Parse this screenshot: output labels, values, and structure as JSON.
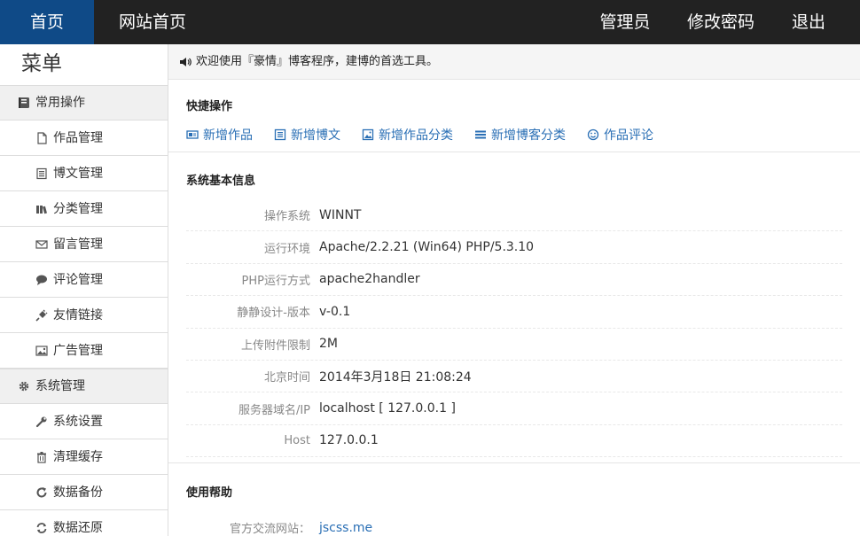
{
  "topbar": {
    "left": [
      "首页",
      "网站首页"
    ],
    "right": [
      "管理员",
      "修改密码",
      "退出"
    ]
  },
  "sidebar": {
    "title": "菜单",
    "groups": [
      {
        "label": "常用操作",
        "icon": "book-icon",
        "items": [
          {
            "label": "作品管理",
            "icon": "file-icon"
          },
          {
            "label": "博文管理",
            "icon": "list-icon"
          },
          {
            "label": "分类管理",
            "icon": "books-icon"
          },
          {
            "label": "留言管理",
            "icon": "envelope-icon"
          },
          {
            "label": "评论管理",
            "icon": "comment-icon"
          },
          {
            "label": "友情链接",
            "icon": "plug-icon"
          },
          {
            "label": "广告管理",
            "icon": "picture-icon"
          }
        ]
      },
      {
        "label": "系统管理",
        "icon": "gear-icon",
        "items": [
          {
            "label": "系统设置",
            "icon": "wrench-icon"
          },
          {
            "label": "清理缓存",
            "icon": "trash-icon"
          },
          {
            "label": "数据备份",
            "icon": "refresh-icon"
          },
          {
            "label": "数据还原",
            "icon": "sync-icon"
          }
        ]
      }
    ]
  },
  "notice": {
    "icon": "speaker-icon",
    "text": "欢迎使用『豪情』博客程序，建博的首选工具。"
  },
  "quick": {
    "title": "快捷操作",
    "links": [
      {
        "label": "新增作品",
        "icon": "card-icon"
      },
      {
        "label": "新增博文",
        "icon": "list-box-icon"
      },
      {
        "label": "新增作品分类",
        "icon": "image-box-icon"
      },
      {
        "label": "新增博客分类",
        "icon": "bars-icon"
      },
      {
        "label": "作品评论",
        "icon": "smile-icon"
      }
    ]
  },
  "sysinfo": {
    "title": "系统基本信息",
    "rows": [
      {
        "label": "操作系统",
        "value": "WINNT"
      },
      {
        "label": "运行环境",
        "value": "Apache/2.2.21 (Win64) PHP/5.3.10"
      },
      {
        "label": "PHP运行方式",
        "value": "apache2handler"
      },
      {
        "label": "静静设计-版本",
        "value": "v-0.1"
      },
      {
        "label": "上传附件限制",
        "value": "2M"
      },
      {
        "label": "北京时间",
        "value": "2014年3月18日 21:08:24"
      },
      {
        "label": "服务器域名/IP",
        "value": "localhost [ 127.0.0.1 ]"
      },
      {
        "label": "Host",
        "value": "127.0.0.1"
      }
    ]
  },
  "help": {
    "title": "使用帮助",
    "rows": [
      {
        "label": "官方交流网站：",
        "value": "jscss.me"
      }
    ]
  }
}
